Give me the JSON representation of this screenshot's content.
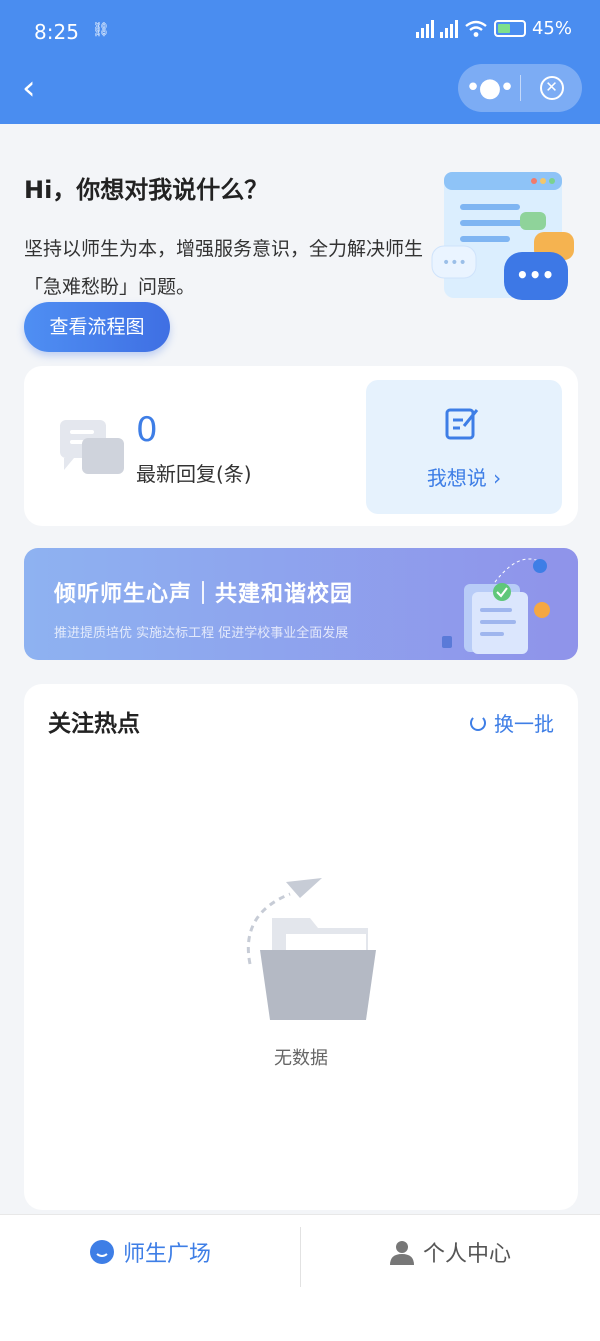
{
  "status_bar": {
    "time": "8:25",
    "battery": "45%"
  },
  "hero": {
    "title": "Hi，你想对我说什么？",
    "description": "坚持以师生为本，增强服务意识，全力解决师生「急难愁盼」问题。",
    "flow_button": "查看流程图"
  },
  "stats": {
    "count": "0",
    "count_label": "最新回复(条)",
    "say_label": "我想说 ›"
  },
  "banner": {
    "title": "倾听师生心声｜共建和谐校园",
    "subtitle": "推进提质培优 实施达标工程 促进学校事业全面发展"
  },
  "hot": {
    "title": "关注热点",
    "refresh_label": "换一批",
    "empty_text": "无数据"
  },
  "tabs": [
    {
      "label": "师生广场",
      "icon": "chat-bubble-icon",
      "active": true
    },
    {
      "label": "个人中心",
      "icon": "person-icon",
      "active": false
    }
  ],
  "colors": {
    "primary": "#4a8df0",
    "accent": "#3e7ee6",
    "background": "#f3f5f8"
  }
}
